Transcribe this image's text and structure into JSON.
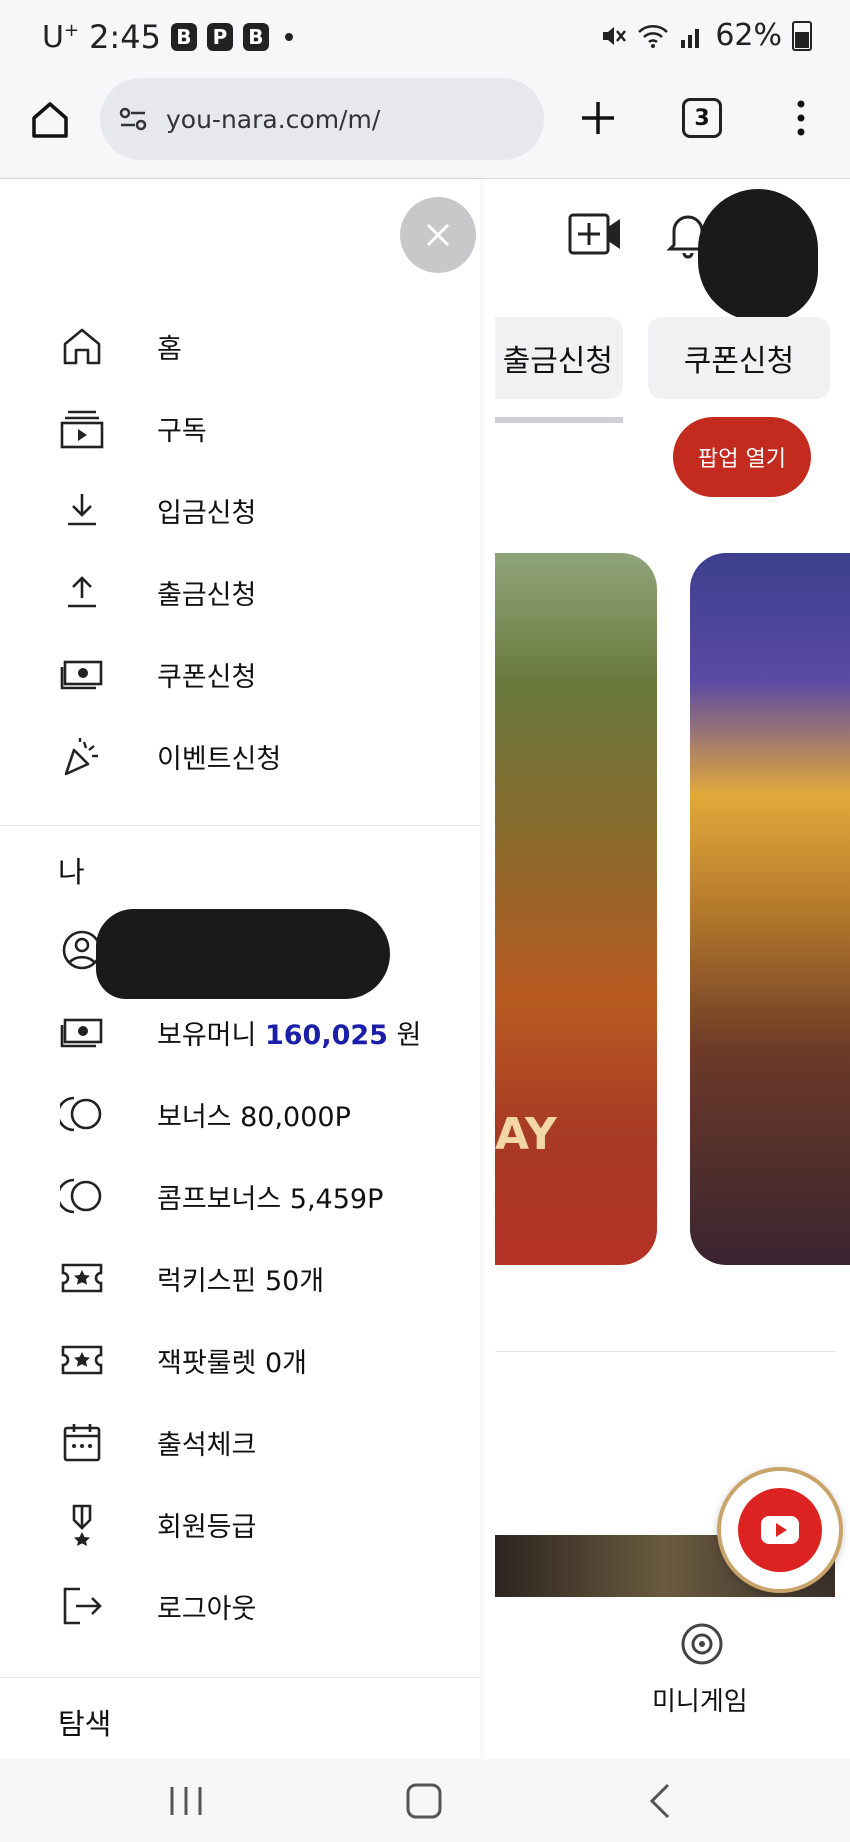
{
  "status_bar": {
    "carrier": "U",
    "carrier_sup": "+",
    "time": "2:45",
    "app_icons": [
      "B",
      "P",
      "B"
    ],
    "battery": "62%"
  },
  "browser": {
    "url": "you-nara.com/m/",
    "tab_count": "3"
  },
  "background_page": {
    "tabs": [
      "출금신청",
      "쿠폰신청"
    ],
    "popup_button": "팝업 열기",
    "banner_text": "AY",
    "bottom_label": "미니게임"
  },
  "drawer": {
    "menu": [
      {
        "label": "홈",
        "icon": "home-icon"
      },
      {
        "label": "구독",
        "icon": "subscriptions-icon"
      },
      {
        "label": "입금신청",
        "icon": "download-icon"
      },
      {
        "label": "출금신청",
        "icon": "upload-icon"
      },
      {
        "label": "쿠폰신청",
        "icon": "money-icon"
      },
      {
        "label": "이벤트신청",
        "icon": "party-popper-icon"
      }
    ],
    "me_section": {
      "title": "나",
      "money_label": "보유머니",
      "money_value": "160,025",
      "money_unit": "원",
      "items": [
        {
          "label": "보너스 80,000P",
          "icon": "coins-icon"
        },
        {
          "label": "콤프보너스 5,459P",
          "icon": "coins-icon"
        },
        {
          "label": "럭키스핀 50개",
          "icon": "ticket-star-icon"
        },
        {
          "label": "잭팟룰렛 0개",
          "icon": "ticket-star-icon"
        },
        {
          "label": "출석체크",
          "icon": "calendar-icon"
        },
        {
          "label": "회원등급",
          "icon": "medal-icon"
        },
        {
          "label": "로그아웃",
          "icon": "logout-icon"
        }
      ]
    },
    "explore_title": "탐색"
  },
  "colors": {
    "accent_money": "#1c1ea8",
    "popup_red": "#c32b1f"
  }
}
